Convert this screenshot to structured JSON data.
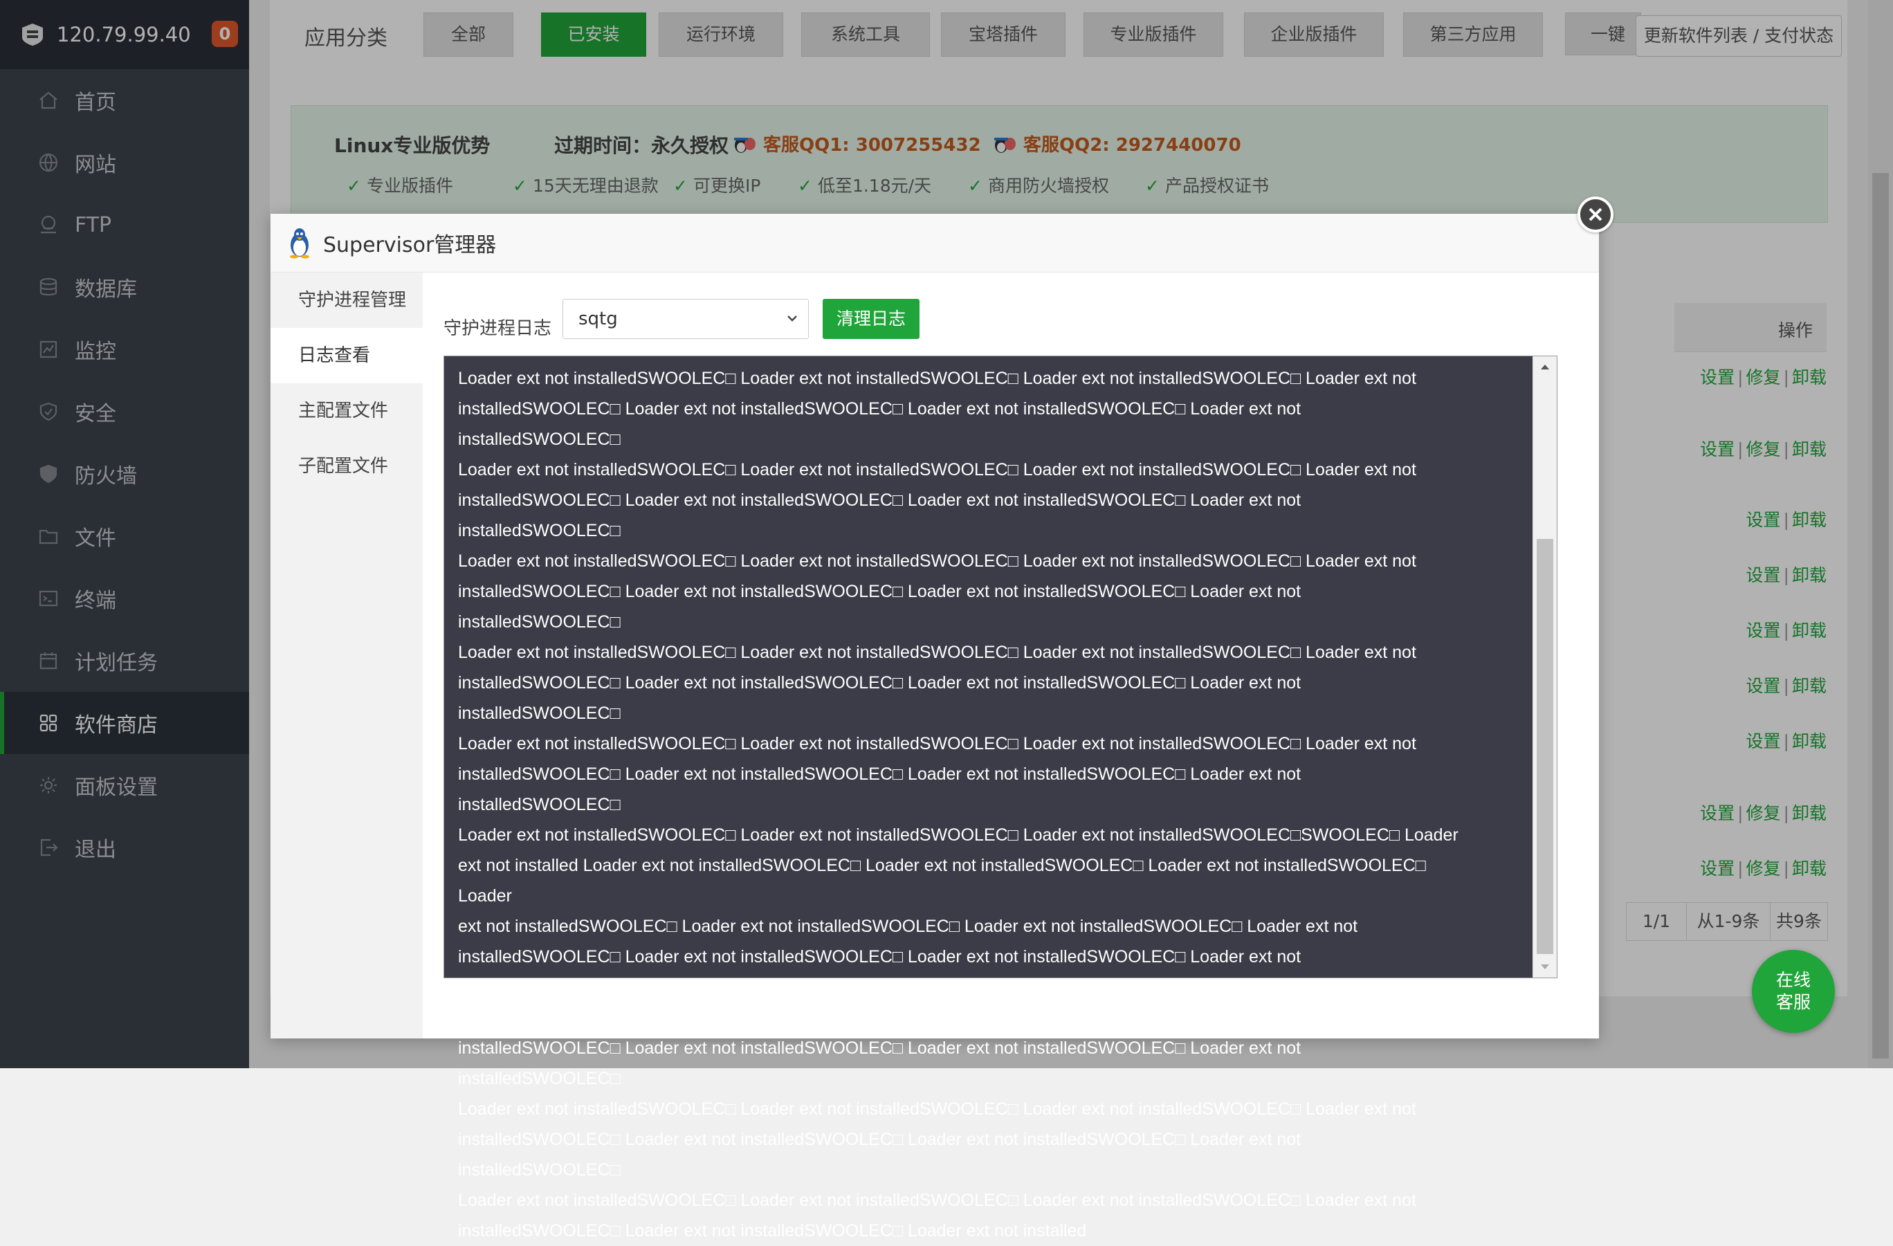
{
  "sidebar": {
    "ip": "120.79.99.40",
    "badge": "0",
    "items": [
      {
        "label": "首页",
        "icon": "home-icon"
      },
      {
        "label": "网站",
        "icon": "globe-icon"
      },
      {
        "label": "FTP",
        "icon": "ftp-icon"
      },
      {
        "label": "数据库",
        "icon": "database-icon"
      },
      {
        "label": "监控",
        "icon": "monitor-icon"
      },
      {
        "label": "安全",
        "icon": "shield-icon"
      },
      {
        "label": "防火墙",
        "icon": "firewall-icon"
      },
      {
        "label": "文件",
        "icon": "folder-icon"
      },
      {
        "label": "终端",
        "icon": "terminal-icon"
      },
      {
        "label": "计划任务",
        "icon": "calendar-icon"
      },
      {
        "label": "软件商店",
        "icon": "grid-icon"
      },
      {
        "label": "面板设置",
        "icon": "gear-icon"
      },
      {
        "label": "退出",
        "icon": "logout-icon"
      }
    ],
    "active_index": 10
  },
  "topbar": {
    "category_label": "应用分类",
    "categories": [
      "全部",
      "已安装",
      "运行环境",
      "系统工具",
      "宝塔插件",
      "专业版插件",
      "企业版插件",
      "第三方应用",
      "一键部"
    ],
    "active_category": "已安装",
    "update_button": "更新软件列表 / 支付状态"
  },
  "advantage": {
    "title": "Linux专业版优势",
    "expire": "过期时间：永久授权",
    "qq1": "客服QQ1: 3007255432",
    "qq2": "客服QQ2: 2927440070",
    "features": [
      "专业版插件",
      "15天无理由退款",
      "可更换IP",
      "低至1.18元/天",
      "商用防火墙授权",
      "产品授权证书"
    ]
  },
  "table": {
    "ops_header": "操作",
    "rows": [
      [
        "设置",
        "修复",
        "卸载"
      ],
      [
        "设置",
        "修复",
        "卸载"
      ],
      [
        "设置",
        "卸载"
      ],
      [
        "设置",
        "卸载"
      ],
      [
        "设置",
        "卸载"
      ],
      [
        "设置",
        "卸载"
      ],
      [
        "设置",
        "卸载"
      ],
      [
        "设置",
        "修复",
        "卸载"
      ],
      [
        "设置",
        "修复",
        "卸载"
      ]
    ]
  },
  "pager": {
    "page": "1/1",
    "range": "从1-9条",
    "total": "共9条"
  },
  "modal": {
    "title": "Supervisor管理器",
    "tabs": [
      "守护进程管理",
      "日志查看",
      "主配置文件",
      "子配置文件"
    ],
    "active_tab": "日志查看",
    "log_label": "守护进程日志",
    "selected_process": "sqtg",
    "clear_button": "清理日志",
    "log_lines": [
      "Loader ext not installedSWOOLEC□ Loader ext not installedSWOOLEC□ Loader ext not installedSWOOLEC□ Loader ext not",
      "installedSWOOLEC□ Loader ext not installedSWOOLEC□ Loader ext not installedSWOOLEC□ Loader ext not installedSWOOLEC□",
      "Loader ext not installedSWOOLEC□ Loader ext not installedSWOOLEC□ Loader ext not installedSWOOLEC□ Loader ext not",
      "installedSWOOLEC□ Loader ext not installedSWOOLEC□ Loader ext not installedSWOOLEC□ Loader ext not installedSWOOLEC□",
      "Loader ext not installedSWOOLEC□ Loader ext not installedSWOOLEC□ Loader ext not installedSWOOLEC□ Loader ext not",
      "installedSWOOLEC□ Loader ext not installedSWOOLEC□ Loader ext not installedSWOOLEC□ Loader ext not installedSWOOLEC□",
      "Loader ext not installedSWOOLEC□ Loader ext not installedSWOOLEC□ Loader ext not installedSWOOLEC□ Loader ext not",
      "installedSWOOLEC□ Loader ext not installedSWOOLEC□ Loader ext not installedSWOOLEC□ Loader ext not installedSWOOLEC□",
      "Loader ext not installedSWOOLEC□ Loader ext not installedSWOOLEC□ Loader ext not installedSWOOLEC□ Loader ext not",
      "installedSWOOLEC□ Loader ext not installedSWOOLEC□ Loader ext not installedSWOOLEC□ Loader ext not installedSWOOLEC□",
      "Loader ext not installedSWOOLEC□ Loader ext not installedSWOOLEC□ Loader ext not installedSWOOLEC□SWOOLEC□ Loader",
      "ext not installed Loader ext not installedSWOOLEC□ Loader ext not installedSWOOLEC□ Loader ext not installedSWOOLEC□ Loader",
      "ext not installedSWOOLEC□ Loader ext not installedSWOOLEC□ Loader ext not installedSWOOLEC□ Loader ext not",
      "installedSWOOLEC□ Loader ext not installedSWOOLEC□ Loader ext not installedSWOOLEC□ Loader ext not installedSWOOLEC□",
      "Loader ext not installedSWOOLEC□ Loader ext not installedSWOOLEC□ Loader ext not installedSWOOLEC□ Loader ext not",
      "installedSWOOLEC□ Loader ext not installedSWOOLEC□ Loader ext not installedSWOOLEC□ Loader ext not installedSWOOLEC□",
      "Loader ext not installedSWOOLEC□ Loader ext not installedSWOOLEC□ Loader ext not installedSWOOLEC□ Loader ext not",
      "installedSWOOLEC□ Loader ext not installedSWOOLEC□ Loader ext not installedSWOOLEC□ Loader ext not installedSWOOLEC□",
      "Loader ext not installedSWOOLEC□ Loader ext not installedSWOOLEC□ Loader ext not installedSWOOLEC□ Loader ext not",
      "installedSWOOLEC□ Loader ext not installedSWOOLEC□ Loader ext not installed"
    ]
  },
  "online_service": "在线客服",
  "colors": {
    "accent": "#20a53a",
    "sidebar": "#3c444d",
    "log_bg": "#3c3c48",
    "badge": "#e0582c"
  }
}
